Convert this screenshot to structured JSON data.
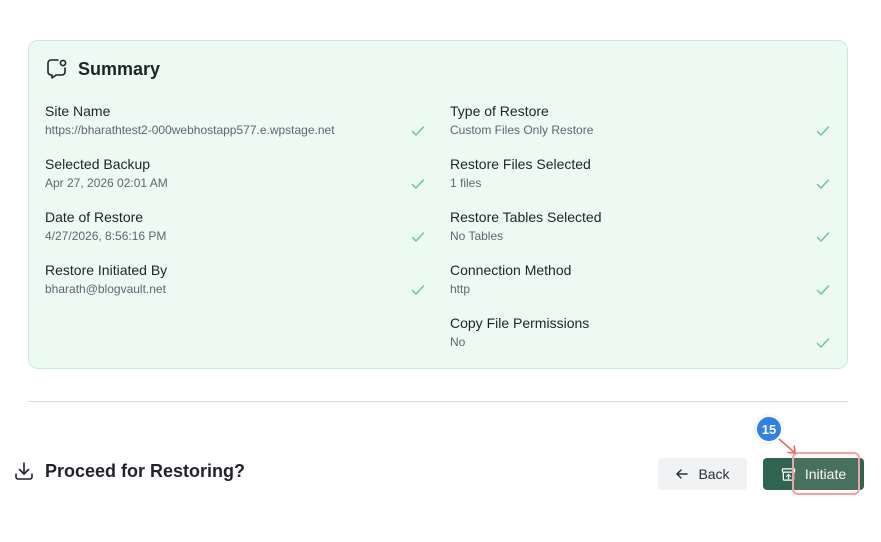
{
  "summary": {
    "title": "Summary",
    "icon": "message-edit-icon",
    "left_items": [
      {
        "label": "Site Name",
        "value": "https://bharathtest2-000webhostapp577.e.wpstage.net"
      },
      {
        "label": "Selected Backup",
        "value": "Apr 27, 2026 02:01 AM"
      },
      {
        "label": "Date of Restore",
        "value": "4/27/2026, 8:56:16 PM"
      },
      {
        "label": "Restore Initiated By",
        "value": "bharath@blogvault.net"
      }
    ],
    "right_items": [
      {
        "label": "Type of Restore",
        "value": "Custom Files Only Restore"
      },
      {
        "label": "Restore Files Selected",
        "value": "1 files"
      },
      {
        "label": "Restore Tables Selected",
        "value": "No Tables"
      },
      {
        "label": "Connection Method",
        "value": "http"
      },
      {
        "label": "Copy File Permissions",
        "value": "No"
      }
    ]
  },
  "proceed": {
    "title": "Proceed for Restoring?",
    "icon": "download-icon"
  },
  "actions": {
    "back_label": "Back",
    "initiate_label": "Initiate"
  },
  "annotation": {
    "step_number": "15"
  },
  "colors": {
    "card_bg": "#ecfaf3",
    "card_border": "#c8ebd8",
    "check": "#6cc79a",
    "primary": "#2f6550",
    "badge": "#2f80ed",
    "highlight": "#f2a3a3"
  }
}
